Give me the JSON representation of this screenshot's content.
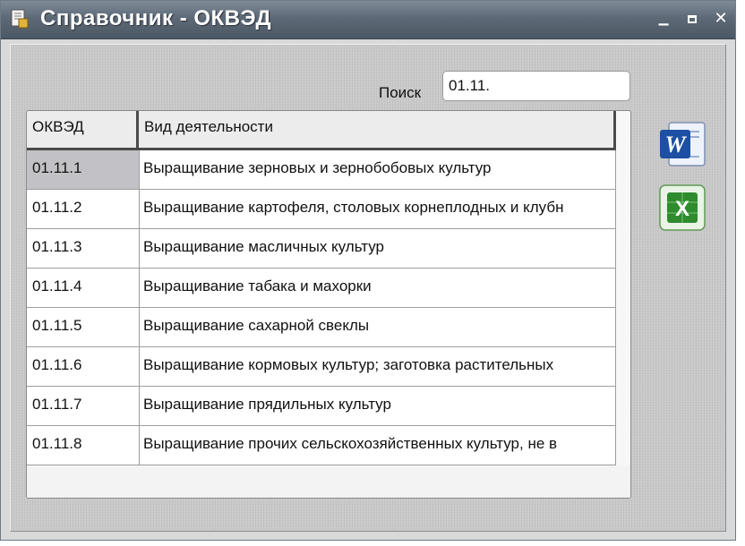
{
  "window": {
    "title": "Справочник - ОКВЭД"
  },
  "search": {
    "label": "Поиск",
    "value": "01.11."
  },
  "table": {
    "columns": [
      "ОКВЭД",
      "Вид деятельности"
    ],
    "rows": [
      {
        "code": "01.11.1",
        "name": "Выращивание зерновых и зернобобовых культур",
        "selected": true
      },
      {
        "code": "01.11.2",
        "name": "Выращивание картофеля, столовых корнеплодных и клубн"
      },
      {
        "code": "01.11.3",
        "name": "Выращивание масличных культур"
      },
      {
        "code": "01.11.4",
        "name": "Выращивание табака и махорки"
      },
      {
        "code": "01.11.5",
        "name": "Выращивание сахарной свеклы"
      },
      {
        "code": "01.11.6",
        "name": "Выращивание кормовых культур; заготовка растительных"
      },
      {
        "code": "01.11.7",
        "name": "Выращивание прядильных культур"
      },
      {
        "code": "01.11.8",
        "name": "Выращивание прочих сельскохозяйственных культур, не в"
      }
    ]
  },
  "icons": {
    "word": "word-export-icon",
    "excel": "excel-export-icon"
  },
  "colors": {
    "title_bar": "#5d6976",
    "selection": "#c2c2c6",
    "word_blue": "#1d4fa3",
    "excel_green": "#2e8b2e"
  }
}
